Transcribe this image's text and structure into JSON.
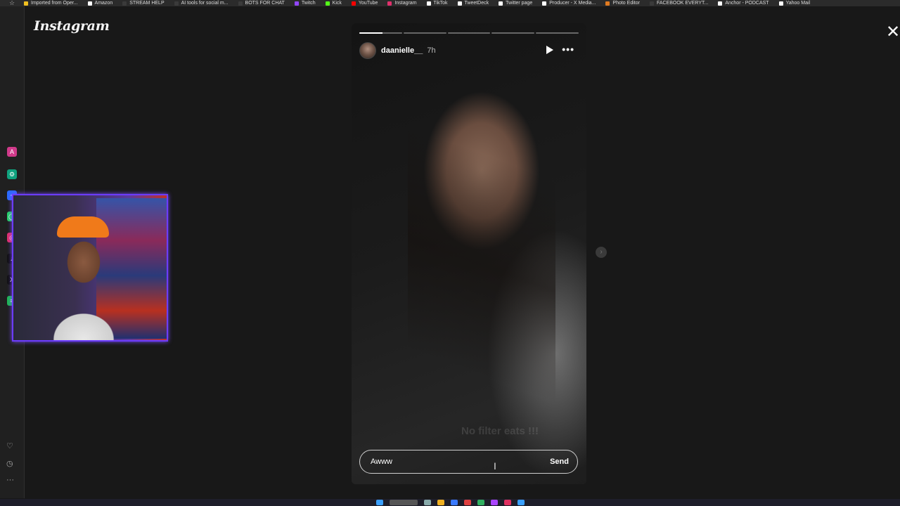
{
  "bookmarks": [
    {
      "label": "Imported from Oper...",
      "color": "#f0c020"
    },
    {
      "label": "Amazon",
      "color": "#ffffff"
    },
    {
      "label": "STREAM HELP",
      "color": "#3a3a3a"
    },
    {
      "label": "AI tools for social m...",
      "color": "#3a3a3a"
    },
    {
      "label": "BOTS FOR CHAT",
      "color": "#3a3a3a"
    },
    {
      "label": "Twitch",
      "color": "#9146ff"
    },
    {
      "label": "Kick",
      "color": "#53fc18"
    },
    {
      "label": "YouTube",
      "color": "#ff0000"
    },
    {
      "label": "Instagram",
      "color": "#e1306c"
    },
    {
      "label": "TikTok",
      "color": "#ffffff"
    },
    {
      "label": "TweetDeck",
      "color": "#ffffff"
    },
    {
      "label": "Twitter page",
      "color": "#ffffff"
    },
    {
      "label": "Producer - X Media...",
      "color": "#ffffff"
    },
    {
      "label": "Photo Editor",
      "color": "#e07a20"
    },
    {
      "label": "FACEBOOK EVERYT...",
      "color": "#3a3a3a"
    },
    {
      "label": "Anchor - PODCAST",
      "color": "#ffffff"
    },
    {
      "label": "Yahoo Mail",
      "color": "#ffffff"
    }
  ],
  "app": {
    "logo": "Instagram",
    "close_icon": "close-icon"
  },
  "story": {
    "progress_segments": [
      0.55,
      0,
      0,
      0,
      0
    ],
    "username": "daanielle__",
    "time_ago": "7h",
    "caption": "No filter eats !!!",
    "reply": {
      "value": "Awww",
      "send_label": "Send"
    }
  },
  "colors": {
    "webcam_border": "#6c3cff",
    "background": "#181818"
  }
}
